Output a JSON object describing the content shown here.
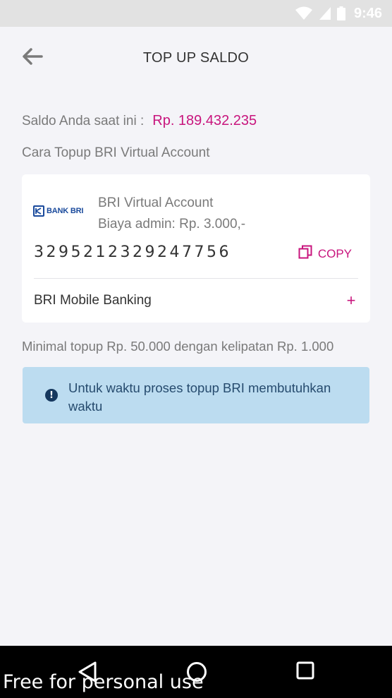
{
  "status_bar": {
    "time": "9:46",
    "icons": [
      "wifi-icon",
      "signal-icon",
      "battery-icon"
    ]
  },
  "header": {
    "title": "TOP UP SALDO",
    "back_icon": "arrow-left-icon"
  },
  "saldo": {
    "label": "Saldo Anda saat ini :",
    "value": "Rp. 189.432.235"
  },
  "cara_label": "Cara Topup BRI Virtual Account",
  "card": {
    "logo_text": "BANK BRI",
    "va_title": "BRI Virtual Account",
    "va_fee": "Biaya admin: Rp. 3.000,-",
    "va_number": "3295212329247756",
    "copy_label": "COPY",
    "mobile_banking_label": "BRI Mobile Banking",
    "expand_symbol": "+"
  },
  "minimal_note": "Minimal topup Rp. 50.000 dengan kelipatan Rp. 1.000",
  "info": {
    "icon_symbol": "!",
    "text": "Untuk waktu proses topup BRI membutuhkan waktu"
  },
  "watermark": "Free for personal use",
  "colors": {
    "accent": "#c8157d",
    "info_bg": "#bcdcf0",
    "info_text": "#264b6e",
    "bank_blue": "#1a4a9c"
  }
}
